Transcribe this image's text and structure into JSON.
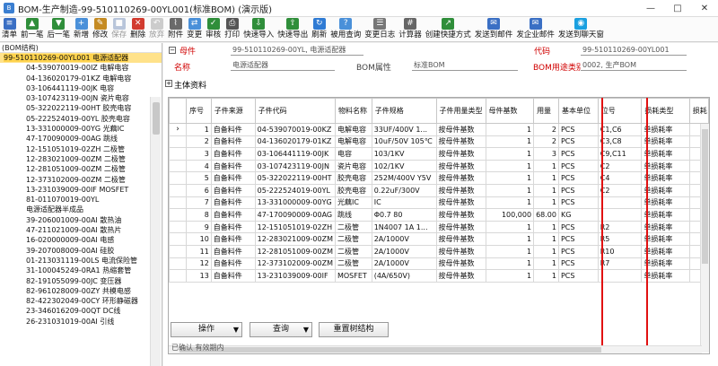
{
  "window": {
    "title": "BOM-生产制造-99-510110269-00YL001(标准BOM) (演示版)",
    "min_glyph": "—",
    "max_glyph": "□",
    "close_glyph": "✕"
  },
  "toolbar": [
    {
      "name": "list",
      "label": "清单",
      "icon": "list-icon",
      "color": "#3a6fc4",
      "glyph": "≡"
    },
    {
      "name": "prev",
      "label": "前一笔",
      "icon": "up-arrow-icon",
      "color": "#2f8e3a",
      "glyph": "▲"
    },
    {
      "name": "next",
      "label": "后一笔",
      "icon": "down-arrow-icon",
      "color": "#2f8e3a",
      "glyph": "▼"
    },
    {
      "name": "add",
      "label": "新增",
      "icon": "new-doc-icon",
      "color": "#4a90d9",
      "glyph": "+"
    },
    {
      "name": "edit",
      "label": "修改",
      "icon": "edit-icon",
      "color": "#c58b23",
      "glyph": "✎"
    },
    {
      "name": "save",
      "label": "保存",
      "icon": "save-icon",
      "color": "#5577aa",
      "glyph": "■",
      "disabled": true
    },
    {
      "name": "delete",
      "label": "删除",
      "icon": "delete-icon",
      "color": "#d23b2f",
      "glyph": "✕"
    },
    {
      "name": "abandon",
      "label": "放弃",
      "icon": "undo-icon",
      "color": "#888",
      "glyph": "↶",
      "disabled": true
    },
    {
      "name": "attach",
      "label": "附件",
      "icon": "paperclip-icon",
      "color": "#6a6a6a",
      "glyph": "⌇"
    },
    {
      "name": "change",
      "label": "变更",
      "icon": "change-icon",
      "color": "#4a90d9",
      "glyph": "⇄"
    },
    {
      "name": "audit",
      "label": "审核",
      "icon": "audit-icon",
      "color": "#2f8e3a",
      "glyph": "✓"
    },
    {
      "name": "print",
      "label": "打印",
      "icon": "printer-icon",
      "color": "#555",
      "glyph": "⎙"
    },
    {
      "name": "quick-import",
      "label": "快速导入",
      "icon": "import-icon",
      "color": "#2f8e3a",
      "glyph": "⇩"
    },
    {
      "name": "quick-export",
      "label": "快速导出",
      "icon": "export-icon",
      "color": "#2f8e3a",
      "glyph": "⇧"
    },
    {
      "name": "refresh",
      "label": "刷新",
      "icon": "refresh-icon",
      "color": "#2f7bd4",
      "glyph": "↻"
    },
    {
      "name": "used-query",
      "label": "被用查询",
      "icon": "query-icon",
      "color": "#4a90d9",
      "glyph": "?"
    },
    {
      "name": "change-log",
      "label": "变更日志",
      "icon": "log-icon",
      "color": "#777",
      "glyph": "☰"
    },
    {
      "name": "calculator",
      "label": "计算器",
      "icon": "calculator-icon",
      "color": "#666",
      "glyph": "#"
    },
    {
      "name": "shortcut",
      "label": "创建快捷方式",
      "icon": "shortcut-icon",
      "color": "#2f8e3a",
      "glyph": "↗"
    },
    {
      "name": "send-mail",
      "label": "发送到邮件",
      "icon": "mail-icon",
      "color": "#3a6fc4",
      "glyph": "✉"
    },
    {
      "name": "send-corp-mail",
      "label": "发企业邮件",
      "icon": "corp-mail-icon",
      "color": "#3a6fc4",
      "glyph": "✉"
    },
    {
      "name": "send-chat",
      "label": "发送到聊天窗",
      "icon": "chat-icon",
      "color": "#1aa0e0",
      "glyph": "◉"
    }
  ],
  "tree": {
    "header": "(BOM结构)",
    "root": "99-510110269-00YL001 电源适配器",
    "children": [
      "04-539070019-00IZ 电解电容",
      "04-136020179-01KZ 电解电容",
      "03-106441119-00JK 电容",
      "03-107423119-00JN 瓷片电容",
      "05-322022119-00HT 胶壳电容",
      "05-222524019-00YL 胶壳电容",
      "13-331000009-00YG 光藕IC",
      "47-170090009-00AG 跳线",
      "12-151051019-02ZH 二极管",
      "12-283021009-00ZM 二极管",
      "12-281051009-00ZM 二极管",
      "12-373102009-00ZM 二极管",
      "13-231039009-00IF MOSFET",
      "81-011070019-00YL",
      "电源适配器半成品",
      "39-206001009-00AI 散热油",
      "47-211021009-00AI 散热片",
      "16-020000009-00AI 电感",
      "39-207008009-00AI 硅胶",
      "01-213031119-00LS 电流保险管",
      "31-100045249-0RA1 热缩套管",
      "82-191055099-00JC 变压器",
      "82-961028009-00ZY 共模电感",
      "82-422302049-00CY 环形静磁器",
      "23-346016209-00QT DC线",
      "26-231031019-00AI 引线"
    ]
  },
  "form": {
    "parent_label": "母件",
    "parent_value": "99-510110269-00YL, 电源适配器",
    "code_label": "代码",
    "code_value": "99-510110269-00YL001",
    "name_label": "名称",
    "name_value": "电源适配器",
    "bom_attr_label": "BOM属性",
    "bom_attr_value": "标准BOM",
    "bom_use_label": "BOM用途类别",
    "bom_use_value": "0002, 生产BOM",
    "main_section": "主体资料"
  },
  "grid": {
    "columns": [
      "序号",
      "子件来源",
      "子件代码",
      "物料名称",
      "子件规格",
      "子件用量类型",
      "母件基数",
      "用量",
      "基本单位",
      "位号",
      "损耗类型",
      "损耗"
    ],
    "rows": [
      [
        "1",
        "自备料件",
        "04-539070019-00KZ",
        "电解电容",
        "33UF/400V 1...",
        "按母件基数",
        "1",
        "2",
        "PCS",
        "C1,C6",
        "单损耗率",
        ""
      ],
      [
        "2",
        "自备料件",
        "04-136020179-01KZ",
        "电解电容",
        "10uF/50V 105℃",
        "按母件基数",
        "1",
        "2",
        "PCS",
        "C3,C8",
        "单损耗率",
        ""
      ],
      [
        "3",
        "自备料件",
        "03-106441119-00JK",
        "电容",
        "103/1KV",
        "按母件基数",
        "1",
        "3",
        "PCS",
        "C9,C11",
        "单损耗率",
        ""
      ],
      [
        "4",
        "自备料件",
        "03-107423119-00JN",
        "瓷片电容",
        "102/1KV",
        "按母件基数",
        "1",
        "1",
        "PCS",
        "C2",
        "单损耗率",
        ""
      ],
      [
        "5",
        "自备料件",
        "05-322022119-00HT",
        "胶壳电容",
        "252M/400V Y5V",
        "按母件基数",
        "1",
        "1",
        "PCS",
        "C4",
        "单损耗率",
        ""
      ],
      [
        "6",
        "自备料件",
        "05-222524019-00YL",
        "胶壳电容",
        "0.22uF/300V",
        "按母件基数",
        "1",
        "1",
        "PCS",
        "C2",
        "单损耗率",
        ""
      ],
      [
        "7",
        "自备料件",
        "13-331000009-00YG",
        "光藕IC",
        "IC",
        "按母件基数",
        "1",
        "1",
        "PCS",
        "",
        "单损耗率",
        ""
      ],
      [
        "8",
        "自备料件",
        "47-170090009-00AG",
        "跳线",
        "Φ0.7 80",
        "按母件基数",
        "100,000",
        "68.00",
        "KG",
        "",
        "单损耗率",
        ""
      ],
      [
        "9",
        "自备料件",
        "12-151051019-02ZH",
        "二极管",
        "1N4007 1A 1...",
        "按母件基数",
        "1",
        "1",
        "PCS",
        "R2",
        "单损耗率",
        ""
      ],
      [
        "10",
        "自备料件",
        "12-283021009-00ZM",
        "二极管",
        "2A/1000V",
        "按母件基数",
        "1",
        "1",
        "PCS",
        "R5",
        "单损耗率",
        ""
      ],
      [
        "11",
        "自备料件",
        "12-281051009-00ZM",
        "二极管",
        "2A/1000V",
        "按母件基数",
        "1",
        "1",
        "PCS",
        "R10",
        "单损耗率",
        ""
      ],
      [
        "12",
        "自备料件",
        "12-373102009-00ZM",
        "二极管",
        "2A/1000V",
        "按母件基数",
        "1",
        "1",
        "PCS",
        "R7",
        "单损耗率",
        ""
      ],
      [
        "13",
        "自备料件",
        "13-231039009-00IF",
        "MOSFET",
        "(4A/650V)",
        "按母件基数",
        "1",
        "1",
        "PCS",
        "",
        "单损耗率",
        ""
      ]
    ],
    "current_marker": "›",
    "highlight_color": "#e11111"
  },
  "buttons": {
    "operate": "操作",
    "query": "查询",
    "reset_tree": "重置树结构",
    "dropdown_glyph": "▼"
  },
  "footer": {
    "status": "已确认 有效期内"
  }
}
